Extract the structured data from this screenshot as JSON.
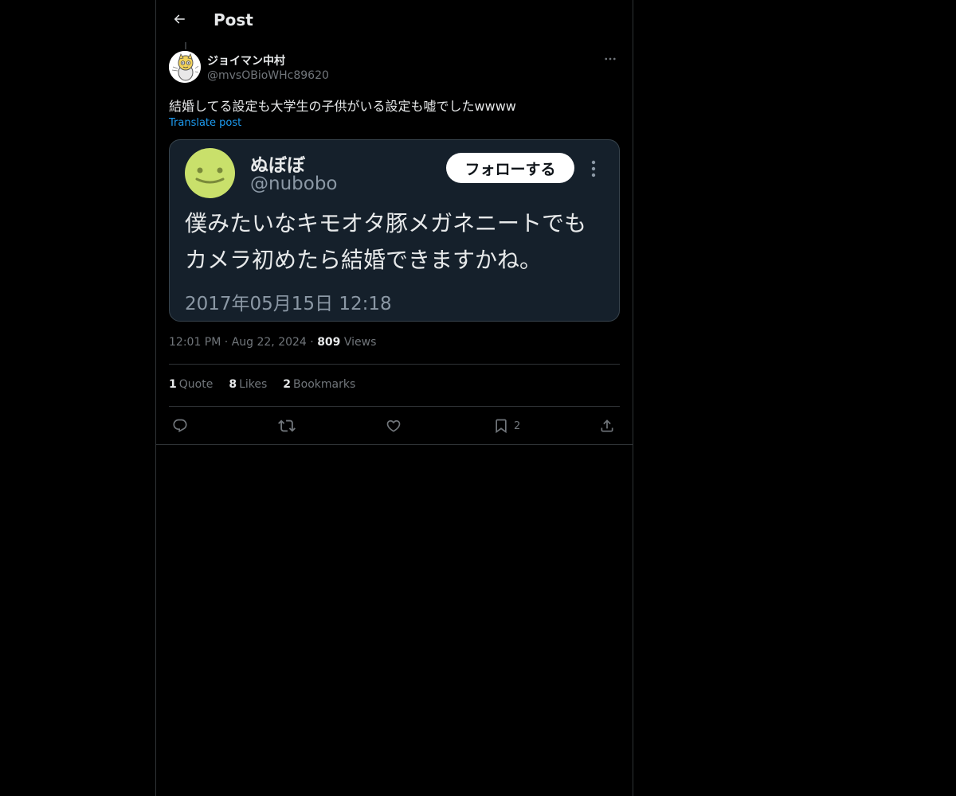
{
  "header": {
    "back_icon": "arrow-left-icon",
    "title": "Post"
  },
  "post": {
    "author": {
      "name": "ジョイマン中村",
      "handle": "@mvsOBioWHc89620",
      "avatar": "cat-illustration-avatar"
    },
    "more_icon": "more-horizontal-icon",
    "text": "結婚してる設定も大学生の子供がいる設定も嘘でしたwwww",
    "translate_label": "Translate post",
    "embedded_screenshot": {
      "name": "ぬぼぼ",
      "handle": "@nubobo",
      "avatar": "smiley-face-avatar",
      "avatar_color": "#c9e06b",
      "follow_label": "フォローする",
      "more_icon": "more-vertical-icon",
      "text_line1": "僕みたいなキモオタ豚メガネニートでも",
      "text_line2": "カメラ初めたら結婚できますかね。",
      "date": "2017年05月15日 12:18"
    },
    "meta": {
      "time": "12:01 PM",
      "separator": "·",
      "date": "Aug 22, 2024",
      "views_count": "809",
      "views_label": "Views"
    },
    "stats": {
      "quotes_count": "1",
      "quotes_label": "Quote",
      "likes_count": "8",
      "likes_label": "Likes",
      "bookmarks_count": "2",
      "bookmarks_label": "Bookmarks"
    },
    "actions": {
      "reply_icon": "reply-icon",
      "repost_icon": "repost-icon",
      "like_icon": "heart-icon",
      "bookmark_icon": "bookmark-icon",
      "bookmark_count": "2",
      "share_icon": "share-icon"
    }
  },
  "colors": {
    "background": "#000000",
    "text_primary": "#e7e9ea",
    "text_secondary": "#71767b",
    "link": "#1d9bf0",
    "border": "#2f3336",
    "embed_background": "#15202b"
  }
}
